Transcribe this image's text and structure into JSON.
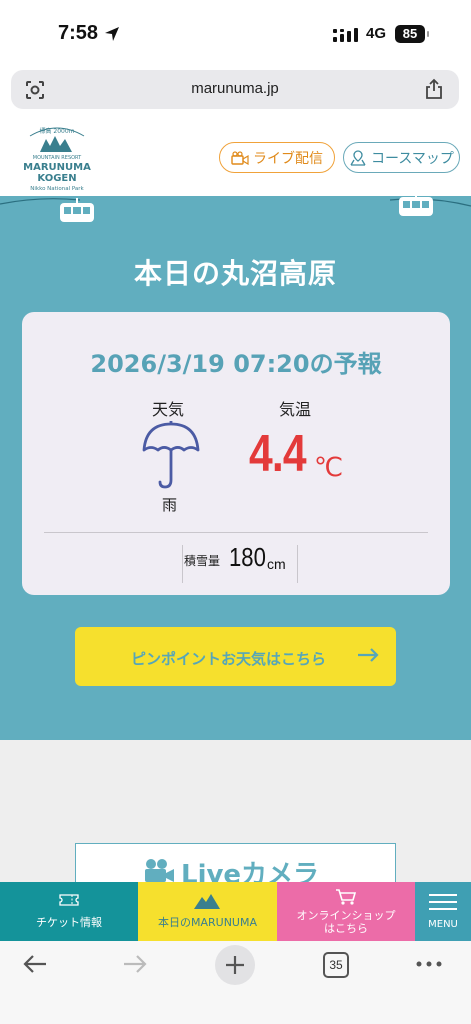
{
  "status": {
    "time": "7:58",
    "network": "4G",
    "battery": "85"
  },
  "browser": {
    "url": "marunuma.jp",
    "tab_count": "35"
  },
  "header": {
    "logo_lines": [
      "標高 2000m",
      "MOUNTAIN RESORT",
      "MARUNUMA",
      "KOGEN",
      "Nikko National Park"
    ],
    "live_label": "ライブ配信",
    "map_label": "コースマップ"
  },
  "main": {
    "title": "本日の丸沼高原",
    "forecast_title": "2026/3/19 07:20の予報",
    "weather_label": "天気",
    "temp_label": "気温",
    "weather_value": "雨",
    "temp_value": "4.4",
    "temp_unit": "℃",
    "snow_label": "積雪量",
    "snow_value": "180",
    "snow_unit": "cm",
    "pinpoint_button": "ピンポイントお天気はこちら",
    "live_camera": "Liveカメラ"
  },
  "bottom_nav": {
    "ticket": "チケット情報",
    "today": "本日のMARUNUMA",
    "shop_line1": "オンラインショップ",
    "shop_line2": "はこちら",
    "menu": "MENU"
  },
  "colors": {
    "teal": "#61aebf",
    "yellow": "#f6e02d",
    "pink": "#ec6ca8",
    "red": "#e33a3a",
    "orange": "#f0a23a"
  }
}
